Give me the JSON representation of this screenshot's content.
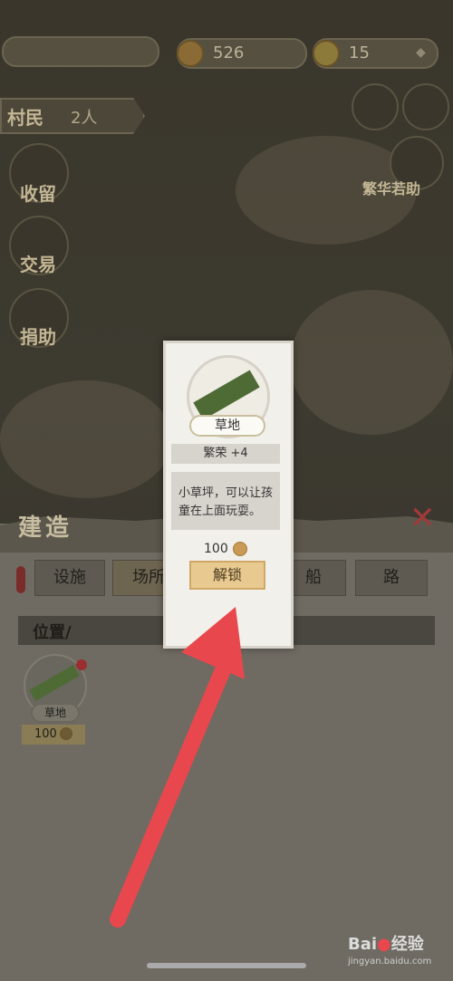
{
  "topbar": {
    "coins": "526",
    "gems": "15"
  },
  "villagers": {
    "label": "村民",
    "count": "2人"
  },
  "side_buttons": [
    {
      "label": "收留"
    },
    {
      "label": "交易"
    },
    {
      "label": "捐助"
    }
  ],
  "right_button": {
    "label": "繁华若助"
  },
  "build_panel": {
    "title": "建造",
    "tabs": [
      "设施",
      "场所",
      "船",
      "路"
    ],
    "position_label": "位置/",
    "card": {
      "name": "草地",
      "price": "100"
    }
  },
  "modal": {
    "name": "草地",
    "prosperity": "繁荣 +4",
    "description": "小草坪，可以让孩童在上面玩耍。",
    "price": "100",
    "unlock_label": "解锁"
  },
  "watermark": {
    "text": "jingyan.baidu.com"
  },
  "colors": {
    "arrow": "#e8474d",
    "grass": "#4e6b36",
    "unlock_button": "#e8c98f"
  }
}
